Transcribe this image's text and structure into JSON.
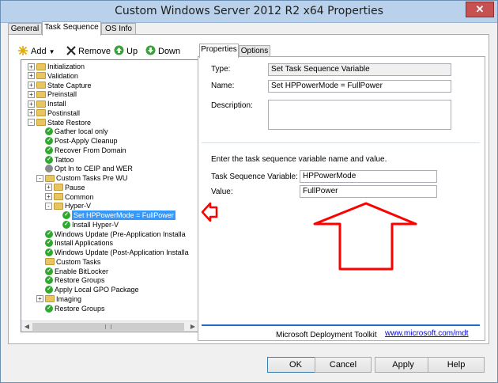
{
  "window": {
    "title": "Custom Windows Server 2012 R2 x64 Properties",
    "close_label": "✕"
  },
  "tabs": [
    {
      "label": "General",
      "active": false
    },
    {
      "label": "Task Sequence",
      "active": true
    },
    {
      "label": "OS Info",
      "active": false
    }
  ],
  "toolbar": {
    "add_label": "Add",
    "remove_label": "Remove",
    "up_label": "Up",
    "down_label": "Down"
  },
  "tree": [
    {
      "label": "Initialization",
      "indent": 0,
      "icon": "folder",
      "expander": "+"
    },
    {
      "label": "Validation",
      "indent": 0,
      "icon": "folder",
      "expander": "+"
    },
    {
      "label": "State Capture",
      "indent": 0,
      "icon": "folder",
      "expander": "+"
    },
    {
      "label": "Preinstall",
      "indent": 0,
      "icon": "folder",
      "expander": "+"
    },
    {
      "label": "Install",
      "indent": 0,
      "icon": "folder",
      "expander": "+"
    },
    {
      "label": "Postinstall",
      "indent": 0,
      "icon": "folder",
      "expander": "+"
    },
    {
      "label": "State Restore",
      "indent": 0,
      "icon": "folder",
      "expander": "-"
    },
    {
      "label": "Gather local only",
      "indent": 1,
      "icon": "check",
      "expander": ""
    },
    {
      "label": "Post-Apply Cleanup",
      "indent": 1,
      "icon": "check",
      "expander": ""
    },
    {
      "label": "Recover From Domain",
      "indent": 1,
      "icon": "check",
      "expander": ""
    },
    {
      "label": "Tattoo",
      "indent": 1,
      "icon": "check",
      "expander": ""
    },
    {
      "label": "Opt In to CEIP and WER",
      "indent": 1,
      "icon": "gear",
      "expander": ""
    },
    {
      "label": "Custom Tasks Pre WU",
      "indent": 1,
      "icon": "folder",
      "expander": "-"
    },
    {
      "label": "Pause",
      "indent": 2,
      "icon": "folder",
      "expander": "+"
    },
    {
      "label": "Common",
      "indent": 2,
      "icon": "folder",
      "expander": "+"
    },
    {
      "label": "Hyper-V",
      "indent": 2,
      "icon": "folder",
      "expander": "-"
    },
    {
      "label": "Set HPPowerMode = FullPower",
      "indent": 3,
      "icon": "check",
      "expander": "",
      "selected": true
    },
    {
      "label": "Install Hyper-V",
      "indent": 3,
      "icon": "check",
      "expander": ""
    },
    {
      "label": "Windows Update (Pre-Application Installa",
      "indent": 1,
      "icon": "check",
      "expander": ""
    },
    {
      "label": "Install Applications",
      "indent": 1,
      "icon": "check",
      "expander": ""
    },
    {
      "label": "Windows Update (Post-Application Installa",
      "indent": 1,
      "icon": "check",
      "expander": ""
    },
    {
      "label": "Custom Tasks",
      "indent": 1,
      "icon": "folder",
      "expander": ""
    },
    {
      "label": "Enable BitLocker",
      "indent": 1,
      "icon": "check",
      "expander": ""
    },
    {
      "label": "Restore Groups",
      "indent": 1,
      "icon": "check",
      "expander": ""
    },
    {
      "label": "Apply Local GPO Package",
      "indent": 1,
      "icon": "check",
      "expander": ""
    },
    {
      "label": "Imaging",
      "indent": 1,
      "icon": "folder",
      "expander": "+"
    },
    {
      "label": "Restore Groups",
      "indent": 1,
      "icon": "check",
      "expander": ""
    }
  ],
  "scroll": {
    "left": "◀",
    "right": "▶"
  },
  "right_tabs": [
    {
      "label": "Properties",
      "active": true
    },
    {
      "label": "Options",
      "active": false
    }
  ],
  "properties": {
    "type_label": "Type:",
    "type_value": "Set Task Sequence Variable",
    "name_label": "Name:",
    "name_value": "Set HPPowerMode = FullPower",
    "description_label": "Description:",
    "description_value": "",
    "instructions": "Enter the task sequence variable name and value.",
    "variable_label": "Task Sequence Variable:",
    "variable_value": "HPPowerMode",
    "value_label": "Value:",
    "value_value": "FullPower",
    "footer_text": "Microsoft Deployment Toolkit",
    "footer_link": "www.microsoft.com/mdt"
  },
  "buttons": {
    "ok": "OK",
    "cancel": "Cancel",
    "apply": "Apply",
    "help": "Help"
  },
  "colors": {
    "selection": "#3399ff",
    "annotation_arrow": "#ff0000"
  }
}
